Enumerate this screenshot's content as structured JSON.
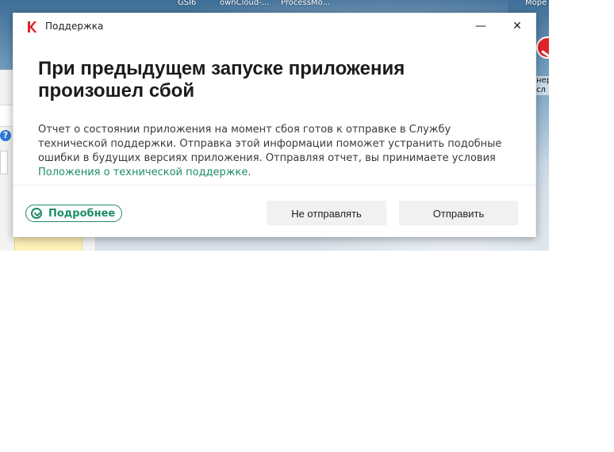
{
  "background": {
    "taskbar_labels": [
      "GSI6",
      "ownCloud-...",
      "ProcessMo...",
      "Море"
    ],
    "side_text": [
      "нер",
      "сл"
    ]
  },
  "dialog": {
    "title": "Поддержка",
    "heading": "При предыдущем запуске приложения произошел сбой",
    "description_prefix": "Отчет о состоянии приложения на момент сбоя готов к отправке в Службу технической поддержки. Отправка этой информации поможет устранить подобные ошибки в будущих версиях приложения. Отправляя отчет, вы принимаете условия ",
    "terms_link": "Положения о технической поддержке",
    "description_suffix": ".",
    "details_button": "Подробнее",
    "dont_send_button": "Не отправлять",
    "send_button": "Отправить"
  },
  "colors": {
    "accent": "#1d8c6b",
    "button_bg": "#f1f1f1",
    "brand_red": "#e1242a"
  },
  "icons": {
    "logo": "kaspersky-logo-icon",
    "minimize": "minimize-icon",
    "close": "close-icon",
    "details": "chevron-down-circle-icon"
  }
}
